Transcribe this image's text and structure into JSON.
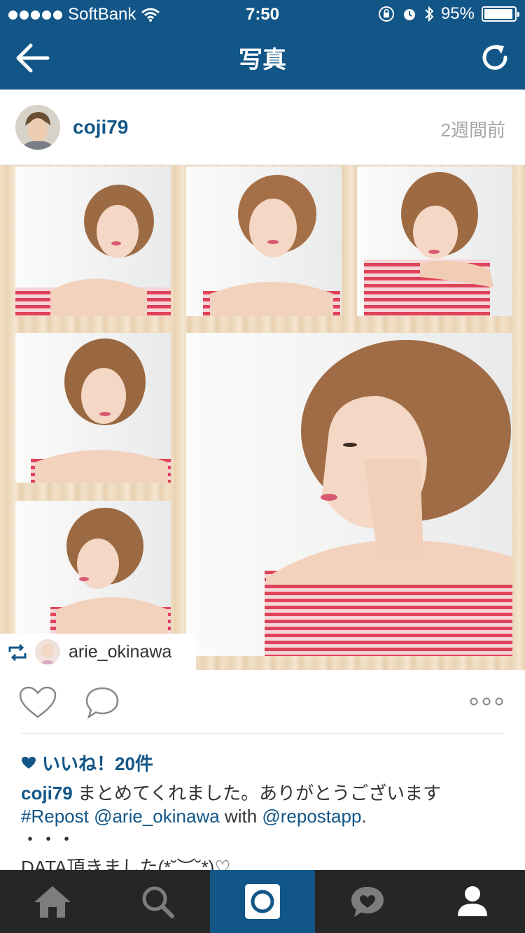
{
  "status_bar": {
    "carrier": "SoftBank",
    "time": "7:50",
    "battery_percent": "95%",
    "battery_level": 0.95,
    "icons": [
      "signal-dots-icon",
      "wifi-icon",
      "orientation-lock-icon",
      "alarm-icon",
      "bluetooth-icon",
      "battery-icon"
    ]
  },
  "nav": {
    "title": "写真",
    "back_icon": "arrow-left-icon",
    "refresh_icon": "refresh-icon"
  },
  "post": {
    "username": "coji79",
    "time_ago": "2週間前",
    "repost_credit": "arie_okinawa",
    "likes": "いいね！20件",
    "caption": {
      "user": "coji79",
      "text": " まとめてくれました。ありがとうございます",
      "hashtag": "#Repost",
      "mention1": "@arie_okinawa",
      "with": " with ",
      "mention2": "@repostapp",
      "period": ".",
      "dots": "・・・",
      "more": "DATA頂きました(*˘︶˘*)♡"
    }
  },
  "tabs": [
    {
      "icon": "home-icon"
    },
    {
      "icon": "search-icon"
    },
    {
      "icon": "camera-icon",
      "active": true
    },
    {
      "icon": "activity-icon"
    },
    {
      "icon": "profile-icon"
    }
  ],
  "colors": {
    "brand": "#125688",
    "tabbar": "#262626",
    "muted": "#a5a7aa"
  }
}
